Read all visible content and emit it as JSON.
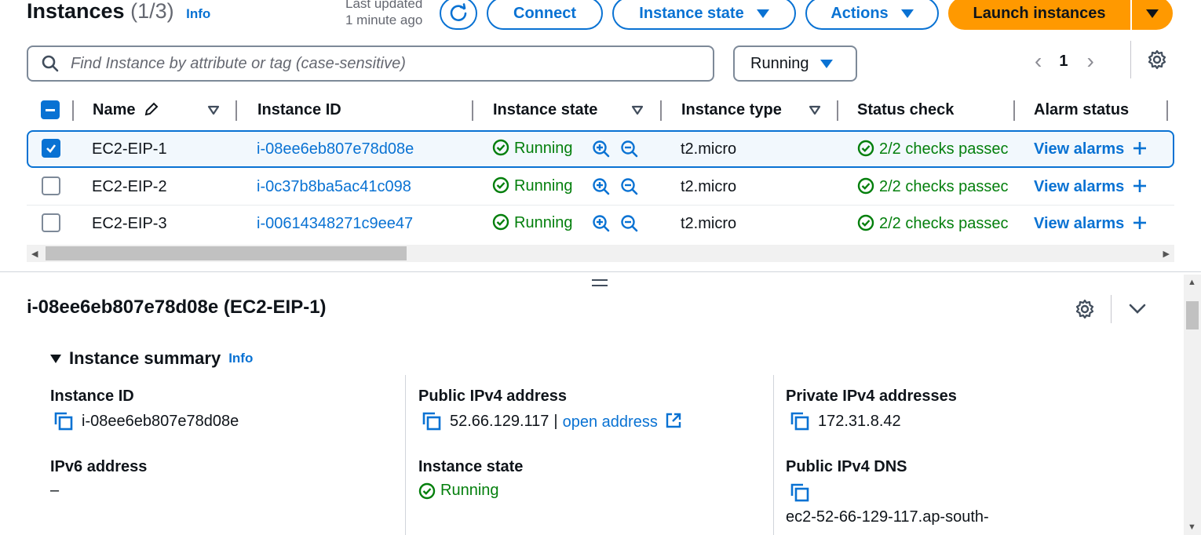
{
  "header": {
    "title": "Instances",
    "count": "(1/3)",
    "info": "Info",
    "last_updated_line1": "Last updated",
    "last_updated_line2": "1 minute ago",
    "connect": "Connect",
    "instance_state": "Instance state",
    "actions": "Actions",
    "launch": "Launch instances"
  },
  "filter": {
    "search_placeholder": "Find Instance by attribute or tag (case-sensitive)",
    "state_filter": "Running"
  },
  "pagination": {
    "current_page": "1"
  },
  "table": {
    "columns": [
      "Name",
      "Instance ID",
      "Instance state",
      "Instance type",
      "Status check",
      "Alarm status"
    ],
    "rows": [
      {
        "selected": true,
        "name": "EC2-EIP-1",
        "id": "i-08ee6eb807e78d08e",
        "state": "Running",
        "type": "t2.micro",
        "status": "2/2 checks passec",
        "alarm": "View alarms"
      },
      {
        "selected": false,
        "name": "EC2-EIP-2",
        "id": "i-0c37b8ba5ac41c098",
        "state": "Running",
        "type": "t2.micro",
        "status": "2/2 checks passec",
        "alarm": "View alarms"
      },
      {
        "selected": false,
        "name": "EC2-EIP-3",
        "id": "i-00614348271c9ee47",
        "state": "Running",
        "type": "t2.micro",
        "status": "2/2 checks passec",
        "alarm": "View alarms"
      }
    ]
  },
  "detail": {
    "title": "i-08ee6eb807e78d08e (EC2-EIP-1)",
    "section": "Instance summary",
    "info": "Info",
    "fields": {
      "instance_id_label": "Instance ID",
      "instance_id_value": "i-08ee6eb807e78d08e",
      "public_ipv4_label": "Public IPv4 address",
      "public_ipv4_value": "52.66.129.117",
      "public_ipv4_sep": "|",
      "open_address": "open address",
      "private_ipv4_label": "Private IPv4 addresses",
      "private_ipv4_value": "172.31.8.42",
      "ipv6_label": "IPv6 address",
      "ipv6_value": "–",
      "state_label": "Instance state",
      "state_value": "Running",
      "public_dns_label": "Public IPv4 DNS",
      "public_dns_value": "ec2-52-66-129-117.ap-south-"
    }
  },
  "colors": {
    "accent": "#0972d3",
    "primary": "#ff9900",
    "success": "#037f0c"
  },
  "icons": [
    "search-icon",
    "refresh-icon",
    "settings-icon",
    "edit-icon",
    "sort-icon",
    "zoom-in-icon",
    "zoom-out-icon",
    "check-circle-icon",
    "plus-icon",
    "copy-icon",
    "external-link-icon",
    "chevron-down-icon"
  ]
}
